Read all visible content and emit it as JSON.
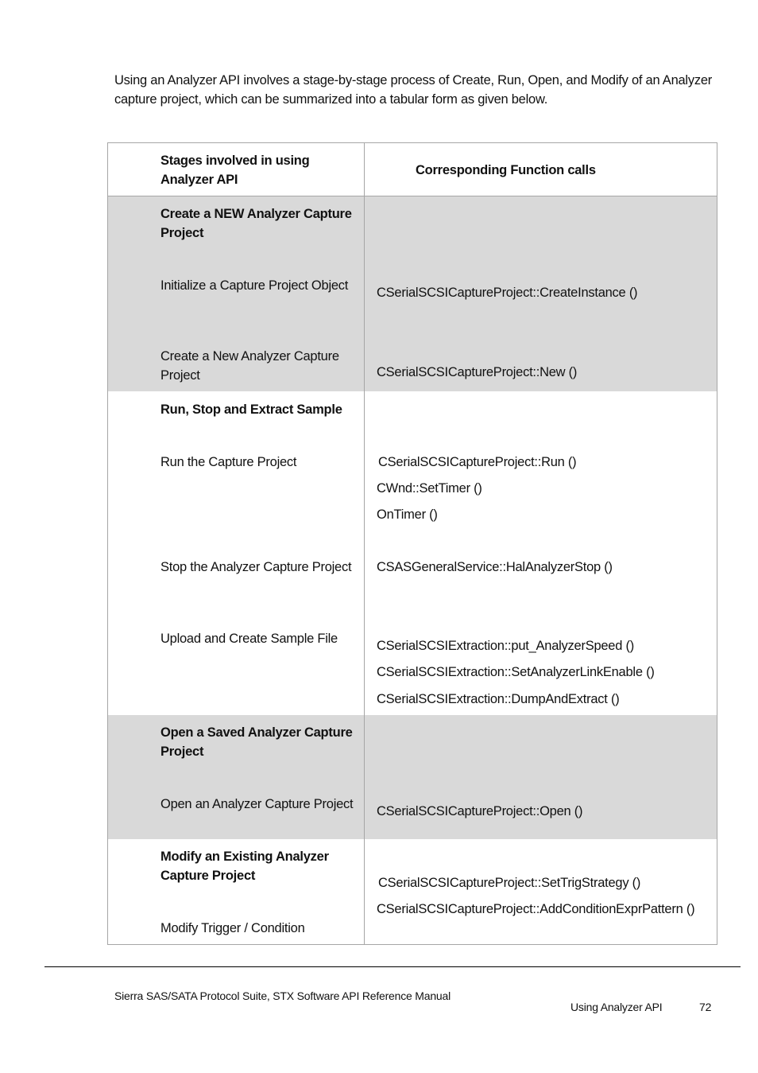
{
  "intro": "Using an Analyzer API involves a stage-by-stage process of Create, Run, Open, and Modify of an Analyzer capture project, which can be summarized into a tabular form as given below.",
  "table": {
    "headers": [
      "Stages involved in using Analyzer API",
      "Corresponding Function calls"
    ],
    "sections": [
      {
        "title": "Create a NEW Analyzer Capture Project",
        "shaded": true,
        "rows": [
          {
            "stage": "Initialize a Capture Project Object",
            "calls": [
              "CSerialSCSICaptureProject::CreateInstance ()"
            ]
          },
          {
            "stage": "Create a New Analyzer Capture Project",
            "calls": [
              "CSerialSCSICaptureProject::New ()"
            ]
          }
        ]
      },
      {
        "title": "Run, Stop and Extract Sample",
        "shaded": false,
        "rows": [
          {
            "stage": "Run the Capture Project",
            "calls": [
              "CSerialSCSICaptureProject::Run ()",
              "CWnd::SetTimer ()",
              "OnTimer ()"
            ]
          },
          {
            "stage": "Stop the Analyzer Capture Project",
            "calls": [
              "CSASGeneralService::HalAnalyzerStop ()"
            ]
          },
          {
            "stage": "Upload and Create Sample File",
            "calls": [
              "CSerialSCSIExtraction::put_AnalyzerSpeed ()",
              "CSerialSCSIExtraction::SetAnalyzerLinkEnable ()",
              "CSerialSCSIExtraction::DumpAndExtract ()"
            ]
          }
        ]
      },
      {
        "title": "Open a Saved Analyzer Capture Project",
        "shaded": true,
        "rows": [
          {
            "stage": "Open an Analyzer Capture Project",
            "calls": [
              "CSerialSCSICaptureProject::Open ()"
            ]
          }
        ]
      },
      {
        "title": "Modify an Existing Analyzer Capture Project",
        "shaded": false,
        "rows": [
          {
            "stage": "Modify Trigger / Condition",
            "calls": [
              "CSerialSCSICaptureProject::SetTrigStrategy ()",
              "CSerialSCSICaptureProject::AddConditionExprPattern ()"
            ]
          }
        ]
      }
    ]
  },
  "footer": {
    "manual_title": "Sierra SAS/SATA Protocol Suite, STX Software API Reference Manual",
    "section": "Using Analyzer API",
    "page_number": "72"
  }
}
